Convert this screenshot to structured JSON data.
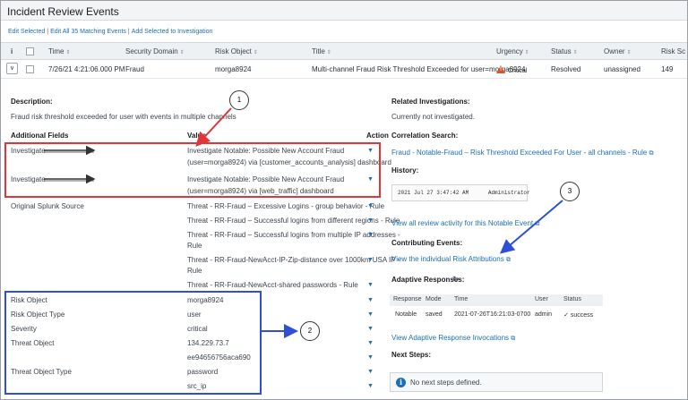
{
  "page": {
    "title": "Incident Review Events"
  },
  "actions": {
    "edit_selected": "Edit Selected",
    "edit_all": "Edit All 35 Matching Events",
    "add_to_investigation": "Add Selected to Investigation"
  },
  "table": {
    "headers": [
      "i",
      "Time",
      "Security Domain",
      "Risk Object",
      "Title",
      "Urgency",
      "Status",
      "Owner",
      "Risk Sc"
    ],
    "row": {
      "time": "7/26/21 4:21:06.000 PM",
      "security_domain": "Fraud",
      "risk_object": "morga8924",
      "title": "Multi-channel Fraud Risk Threshold Exceeded for user=morga8924",
      "urgency": "Critical",
      "status": "Resolved",
      "owner": "unassigned",
      "risk_score": "149"
    }
  },
  "details": {
    "description_label": "Description:",
    "description_text": "Fraud risk threshold exceeded for user with events in multiple channels",
    "additional_fields_label": "Additional Fields",
    "value_label": "Value",
    "action_label": "Action",
    "investigate_rows": [
      {
        "label": "Investigate",
        "value_line1": "Investigate Notable: Possible New Account Fraud",
        "value_line2": "(user=morga8924) via [customer_accounts_analysis] dashboard"
      },
      {
        "label": "Investigate",
        "value_line1": "Investigate Notable: Possible New Account Fraud",
        "value_line2": "(user=morga8924) via [web_traffic] dashboard"
      }
    ],
    "original_source_label": "Original Splunk Source",
    "sources": [
      "Threat - RR-Fraud – Excessive Logins - group behavior - Rule",
      "Threat - RR-Fraud – Successful logins from different regions - Rule",
      "Threat - RR-Fraud – Successful logins from multiple IP addresses -",
      "Rule",
      "Threat - RR-Fraud-NewAcct-IP-Zip-distance over 1000km USA IP -",
      "Rule",
      "Threat - RR-Fraud-NewAcct-shared passwords - Rule"
    ],
    "risk_fields": [
      {
        "label": "Risk Object",
        "value": "morga8924"
      },
      {
        "label": "Risk Object Type",
        "value": "user"
      },
      {
        "label": "Severity",
        "value": "critical"
      },
      {
        "label": "Threat Object",
        "value": "134.229.73.7"
      },
      {
        "label": "",
        "value": "ee94656756aca690"
      },
      {
        "label": "Threat Object Type",
        "value": "password"
      },
      {
        "label": "",
        "value": "src_ip"
      }
    ]
  },
  "right": {
    "related_label": "Related Investigations:",
    "related_text": "Currently not investigated.",
    "correlation_label": "Correlation Search:",
    "correlation_link": "Fraud - Notable-Fraud – Risk Threshold Exceeded For User - all channels - Rule",
    "history_label": "History:",
    "history_date": "2021 Jul 27 3:47:42 AM",
    "history_user": "Administrator",
    "history_link": "View all review activity for this Notable Event",
    "contributing_label": "Contributing Events:",
    "contributing_link": "View the individual Risk Attributions",
    "adaptive_label": "Adaptive Responses:",
    "response_headers": [
      "Response",
      "Mode",
      "Time",
      "User",
      "Status"
    ],
    "response_row": {
      "response": "Notable",
      "mode": "saved",
      "time": "2021-07-26T16:21:03-0700",
      "user": "admin",
      "status": "success"
    },
    "adaptive_link": "View Adaptive Response Invocations",
    "next_steps_label": "Next Steps:",
    "next_steps_text": "No next steps defined."
  },
  "callouts": [
    "1",
    "2",
    "3"
  ],
  "colors": {
    "link": "#1a6fb5",
    "red_box": "#e0363a",
    "blue_box": "#2f4fd8",
    "critical": "#d9532c"
  }
}
